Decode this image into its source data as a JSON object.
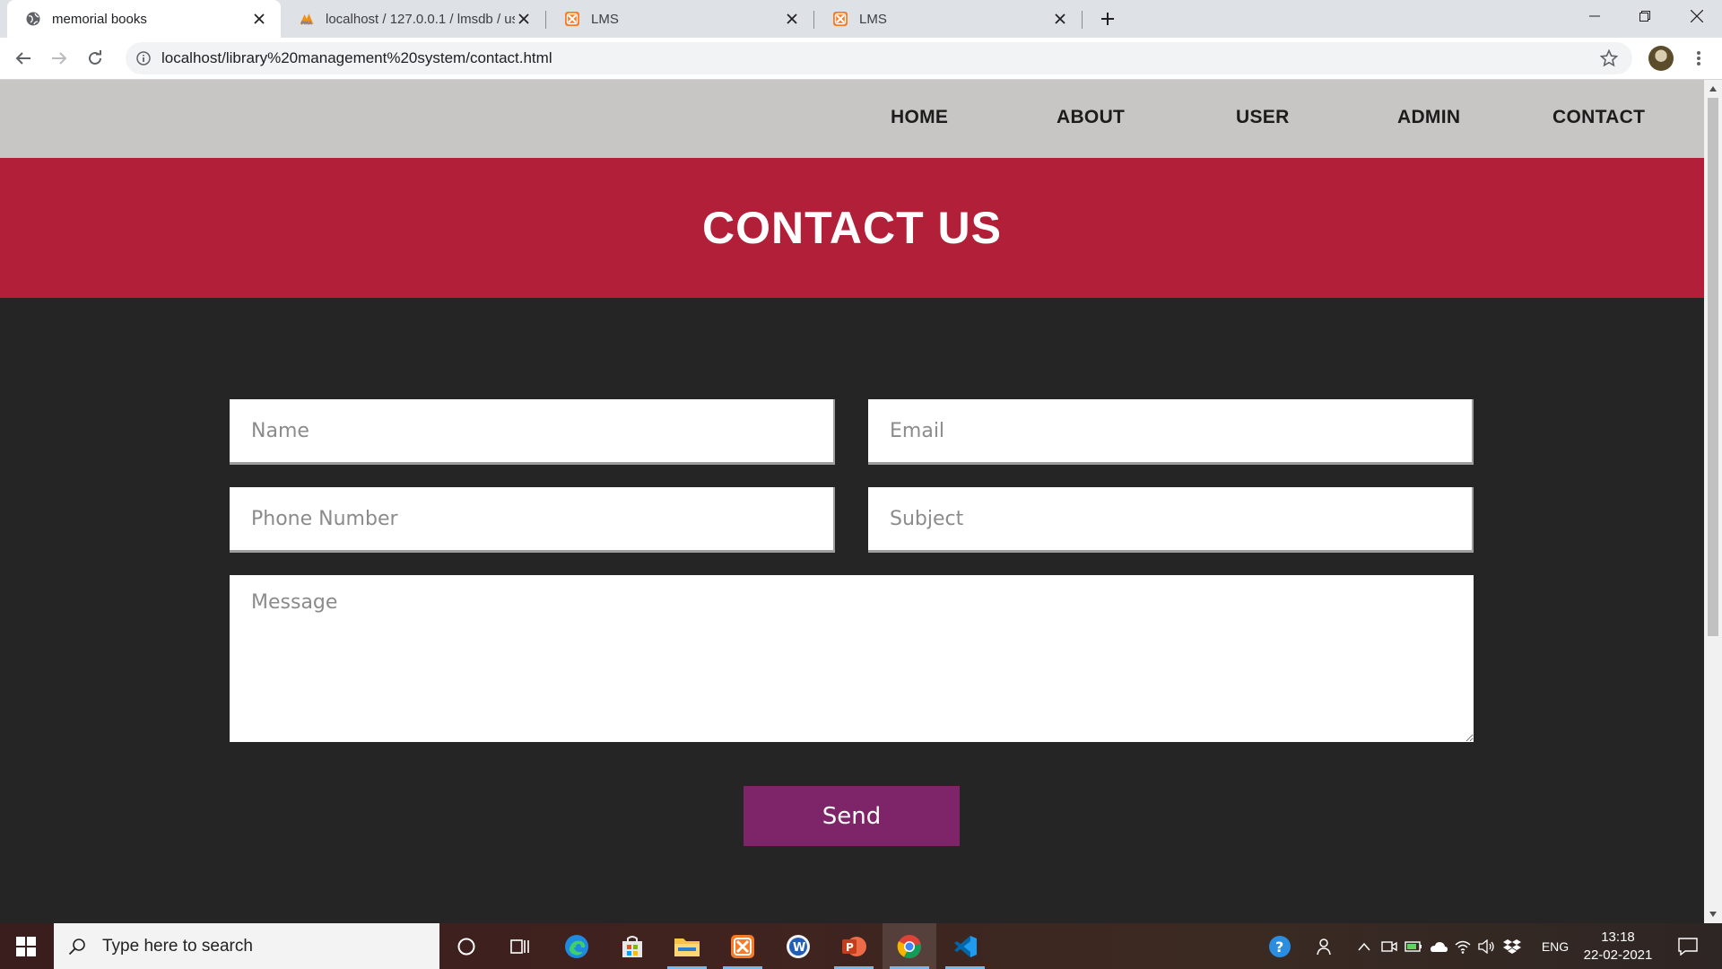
{
  "browser": {
    "tabs": [
      {
        "title": "memorial books",
        "icon": "globe-icon",
        "active": true
      },
      {
        "title": "localhost / 127.0.0.1 / lmsdb / us",
        "icon": "phpmyadmin-icon",
        "active": false
      },
      {
        "title": "LMS",
        "icon": "xampp-icon",
        "active": false
      },
      {
        "title": "LMS",
        "icon": "xampp-icon",
        "active": false
      }
    ],
    "url": "localhost/library%20management%20system/contact.html"
  },
  "nav": {
    "items": [
      "HOME",
      "ABOUT",
      "USER",
      "ADMIN",
      "CONTACT"
    ]
  },
  "banner": {
    "title": "CONTACT US"
  },
  "form": {
    "name_placeholder": "Name",
    "email_placeholder": "Email",
    "phone_placeholder": "Phone Number",
    "subject_placeholder": "Subject",
    "message_placeholder": "Message",
    "send_label": "Send"
  },
  "taskbar": {
    "search_placeholder": "Type here to search",
    "language": "ENG",
    "time": "13:18",
    "date": "22-02-2021",
    "pinned": [
      "cortana-icon",
      "task-view-icon",
      "edge-icon",
      "store-icon",
      "file-explorer-icon",
      "xampp-icon",
      "word-icon",
      "powerpoint-icon",
      "chrome-icon",
      "vscode-icon"
    ]
  },
  "colors": {
    "navbar": "#c8c5c5",
    "banner": "#b11f38",
    "page_background": "#252525",
    "send_button": "#7e2468"
  }
}
